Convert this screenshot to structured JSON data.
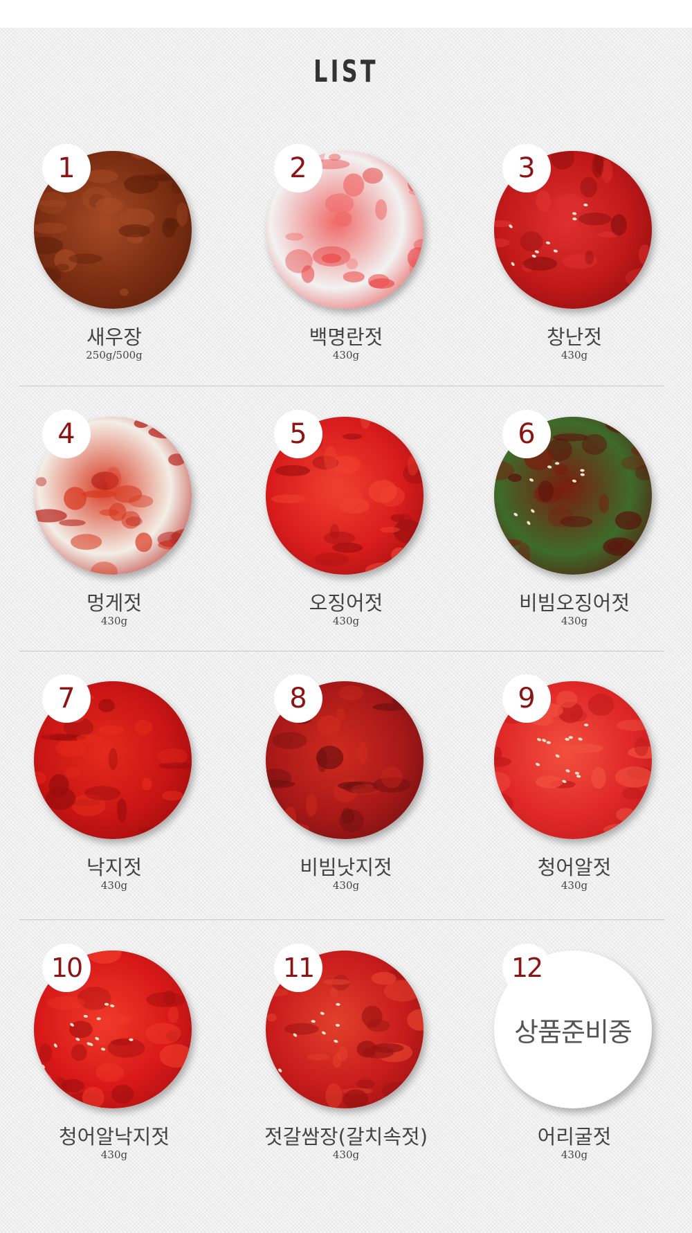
{
  "title": "LIST",
  "placeholder_text": "상품준비중",
  "products": [
    {
      "num": "1",
      "name": "새우장",
      "weight": "250g/500g",
      "colors": [
        "#7a2d12",
        "#a54a24",
        "#5e1f0a"
      ]
    },
    {
      "num": "2",
      "name": "백명란젓",
      "weight": "430g",
      "colors": [
        "#f2f2f2",
        "#f06a6a",
        "#e94848"
      ]
    },
    {
      "num": "3",
      "name": "창난젓",
      "weight": "430g",
      "colors": [
        "#c01818",
        "#e03030",
        "#8a0e0e"
      ]
    },
    {
      "num": "4",
      "name": "멍게젓",
      "weight": "430g",
      "colors": [
        "#f3eee6",
        "#d83a22",
        "#b5201a"
      ]
    },
    {
      "num": "5",
      "name": "오징어젓",
      "weight": "430g",
      "colors": [
        "#d81c1c",
        "#f04030",
        "#a01010"
      ]
    },
    {
      "num": "6",
      "name": "비빔오징어젓",
      "weight": "430g",
      "colors": [
        "#3d6b2a",
        "#7a1c10",
        "#5a140c"
      ]
    },
    {
      "num": "7",
      "name": "낙지젓",
      "weight": "430g",
      "colors": [
        "#c81414",
        "#e52a1c",
        "#9a0c0c"
      ]
    },
    {
      "num": "8",
      "name": "비빔낫지젓",
      "weight": "430g",
      "colors": [
        "#a81818",
        "#d02a1e",
        "#6e1010"
      ]
    },
    {
      "num": "9",
      "name": "청어알젓",
      "weight": "430g",
      "colors": [
        "#e02828",
        "#f25040",
        "#c01a1a"
      ]
    },
    {
      "num": "10",
      "name": "청어알낙지젓",
      "weight": "430g",
      "colors": [
        "#d81818",
        "#f03a2a",
        "#a81010"
      ]
    },
    {
      "num": "11",
      "name": "젓갈쌈장(갈치속젓)",
      "weight": "430g",
      "colors": [
        "#c81c1c",
        "#e2402c",
        "#9a1212"
      ]
    },
    {
      "num": "12",
      "name": "어리굴젓",
      "weight": "430g",
      "colors": []
    }
  ]
}
